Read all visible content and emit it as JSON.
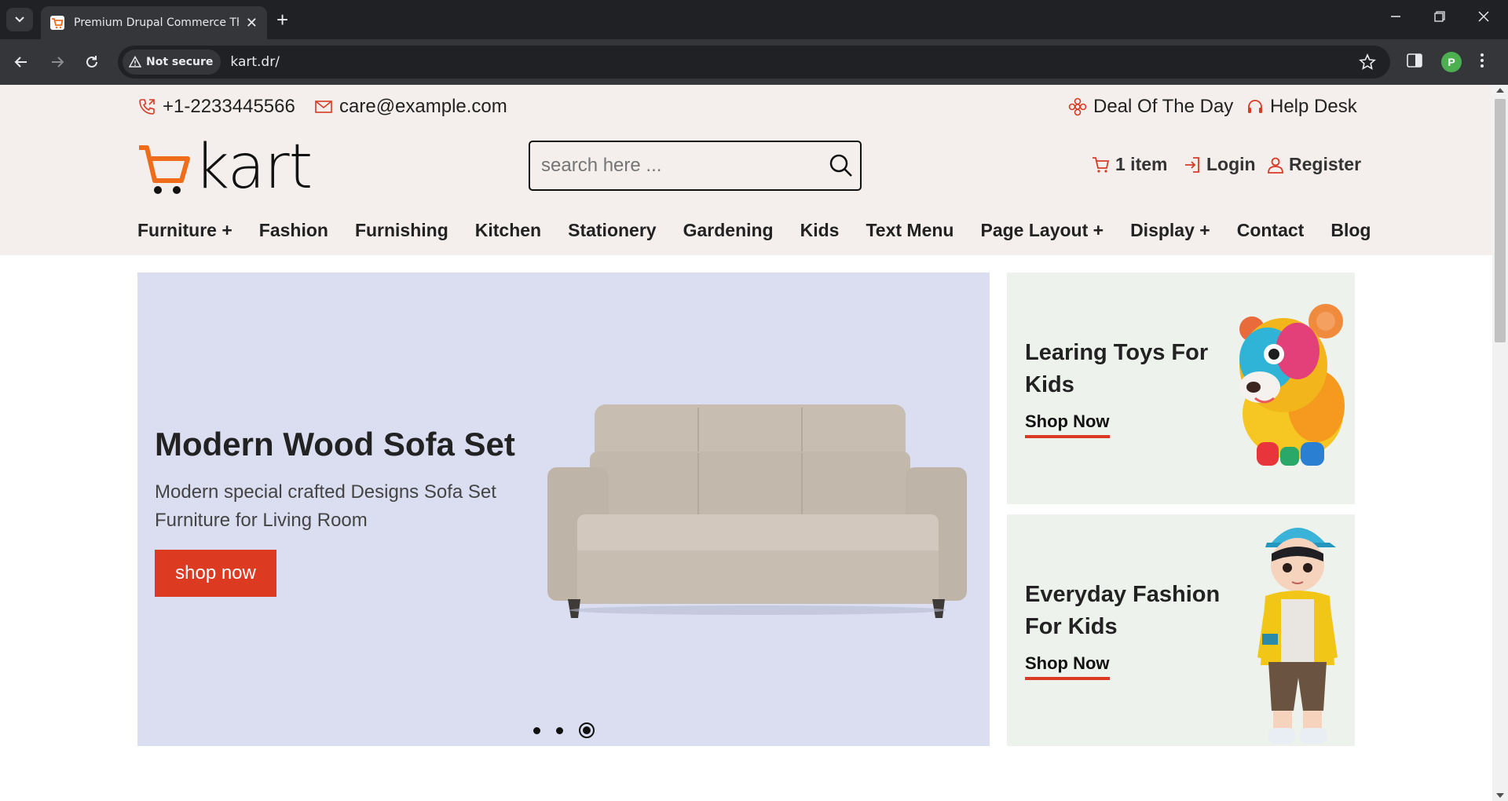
{
  "browser": {
    "tab_title": "Premium Drupal Commerce The",
    "security_label": "Not secure",
    "url": "kart.dr/",
    "profile_initial": "P"
  },
  "colors": {
    "accent": "#dd3a22",
    "header_bg": "#f4efed",
    "hero_bg": "#dadef0",
    "promo_bg": "#eef2ec",
    "logo_cart": "#ef6c1a"
  },
  "topbar": {
    "phone": "+1-2233445566",
    "email": "care@example.com",
    "deal": "Deal Of The Day",
    "help": "Help Desk"
  },
  "header": {
    "logo_text": "kart",
    "search_placeholder": "search here ...",
    "cart_label": "1 item",
    "login_label": "Login",
    "register_label": "Register"
  },
  "menu": [
    "Furniture +",
    "Fashion",
    "Furnishing",
    "Kitchen",
    "Stationery",
    "Gardening",
    "Kids",
    "Text Menu",
    "Page Layout +",
    "Display +",
    "Contact",
    "Blog"
  ],
  "hero": {
    "title": "Modern Wood Sofa Set",
    "subtitle": "Modern special crafted Designs Sofa Set Furniture for Living Room",
    "button": "shop now",
    "slide_count": 3,
    "active_slide": 3
  },
  "promos": [
    {
      "title": "Learing Toys For Kids",
      "link": "Shop Now"
    },
    {
      "title": "Everyday Fashion For Kids",
      "link": "Shop Now"
    }
  ]
}
